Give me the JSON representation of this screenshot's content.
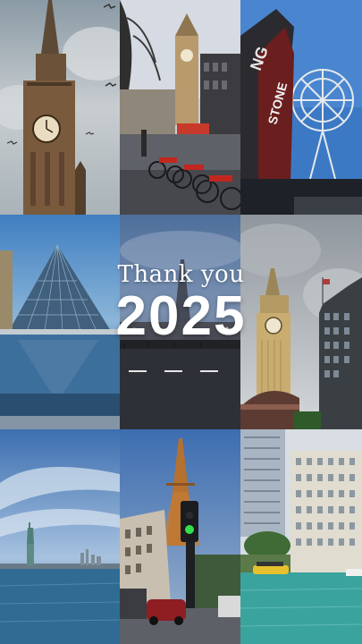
{
  "caption": {
    "line1": "Thank you",
    "line2": "2025"
  },
  "tiles": [
    {
      "subject": "Big Ben clock tower with birds"
    },
    {
      "subject": "London street with rental bikes and Big Ben"
    },
    {
      "subject": "Ferris wheel and neon sign"
    },
    {
      "subject": "Louvre glass pyramid"
    },
    {
      "subject": "Paris street at dusk"
    },
    {
      "subject": "Big Ben under cloudy sky"
    },
    {
      "subject": "Statue of Liberty across the water"
    },
    {
      "subject": "Eiffel Tower with traffic light"
    },
    {
      "subject": "City river with tall buildings and boat"
    }
  ],
  "colors": {
    "caption_text": "#ffffff"
  }
}
